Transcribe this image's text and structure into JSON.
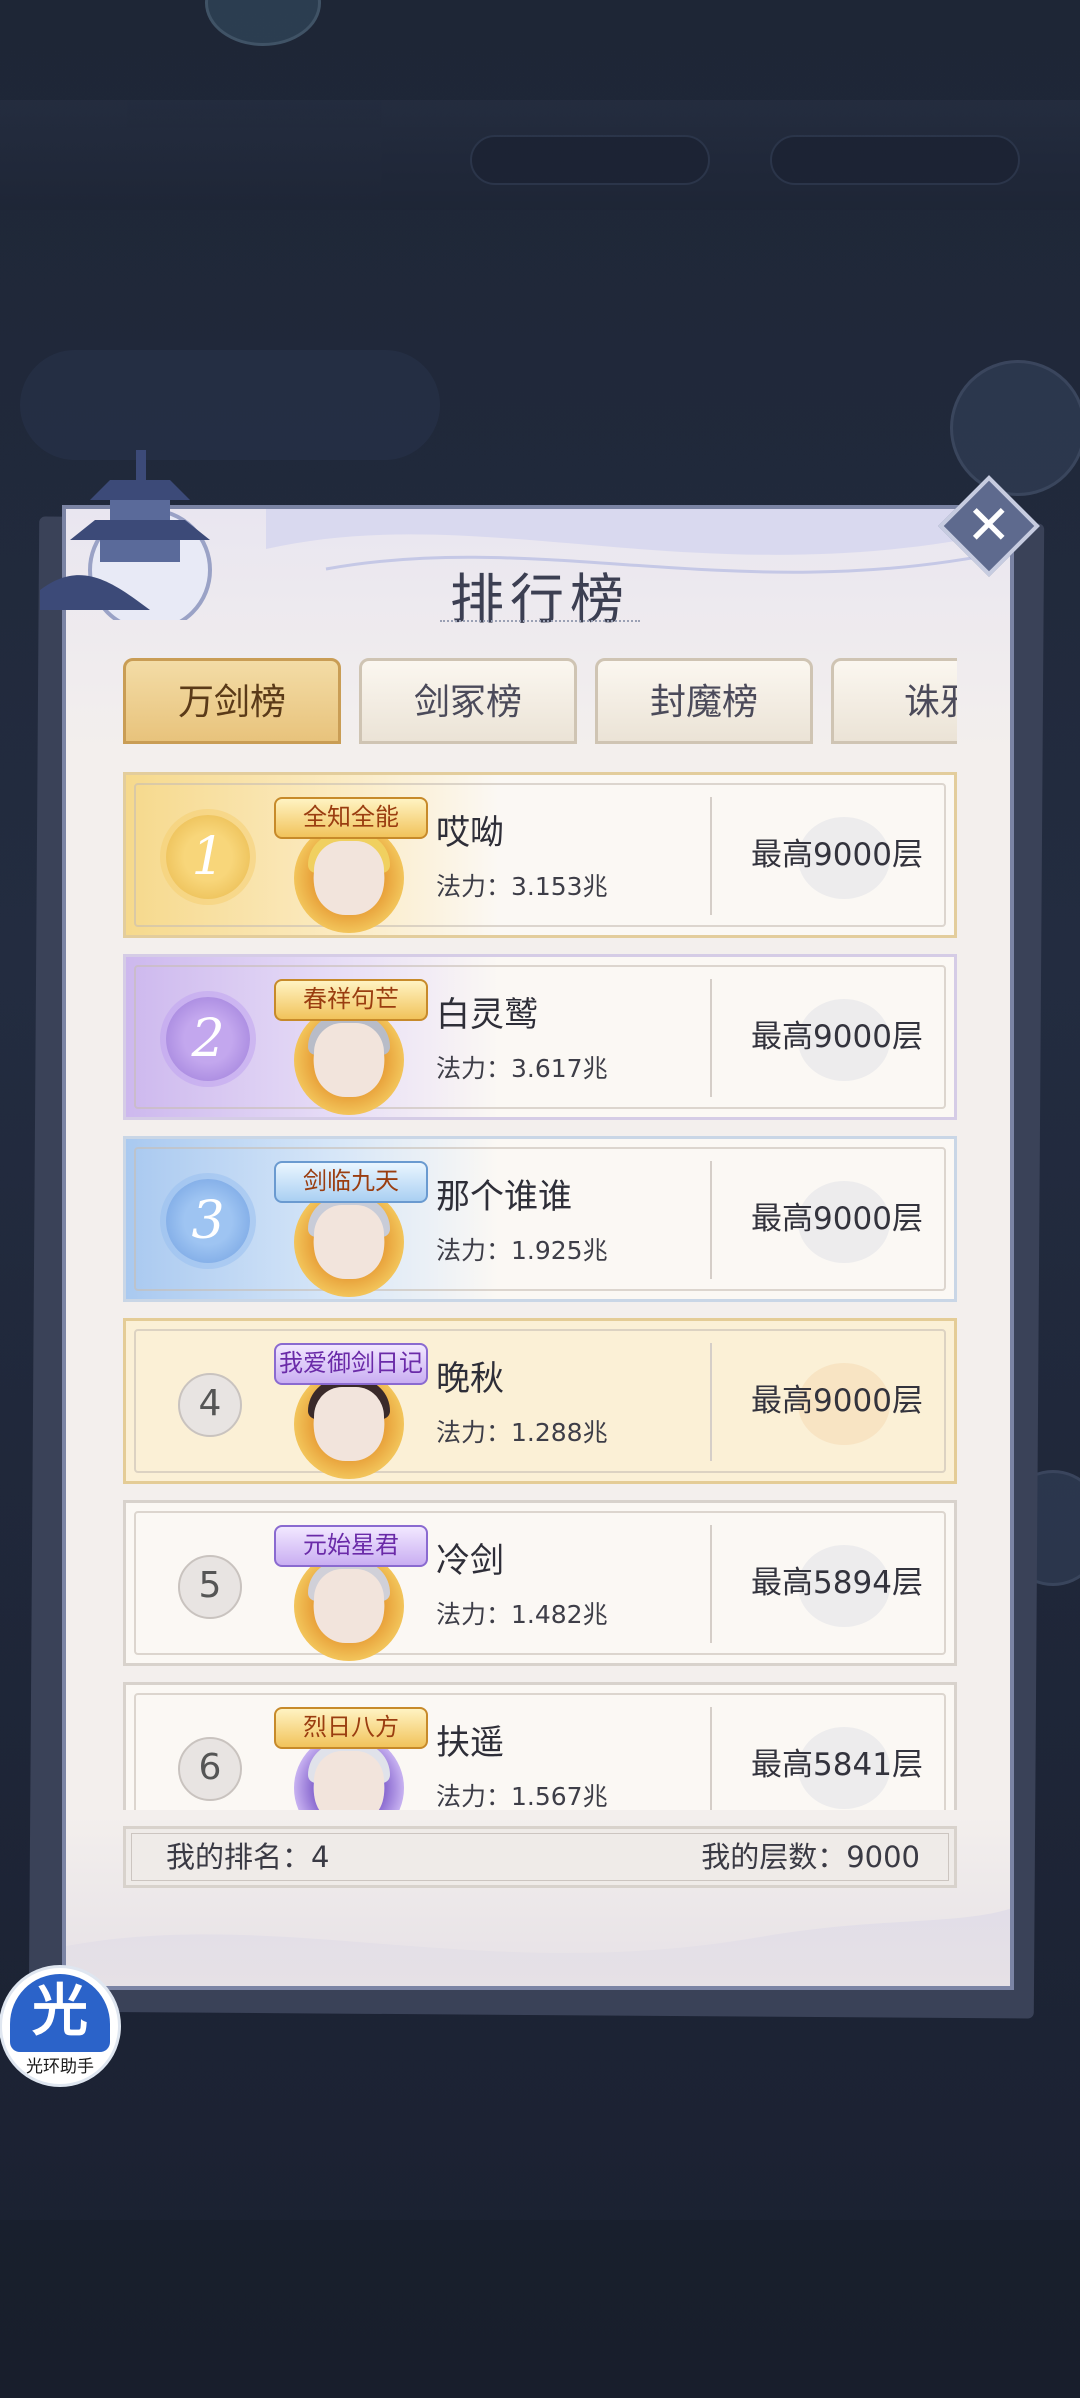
{
  "modal": {
    "title": "排行榜",
    "close_symbol": "✕"
  },
  "tabs": [
    {
      "label": "万剑榜",
      "active": true
    },
    {
      "label": "剑冢榜",
      "active": false
    },
    {
      "label": "封魔榜",
      "active": false
    },
    {
      "label": "诛邪",
      "active": false
    }
  ],
  "ranking": [
    {
      "rank": "1",
      "name": "哎呦",
      "title_badge": "全知全能",
      "power": "法力：3.153兆",
      "record": "最高9000层"
    },
    {
      "rank": "2",
      "name": "白灵鹫",
      "title_badge": "春祥句芒",
      "power": "法力：3.617兆",
      "record": "最高9000层"
    },
    {
      "rank": "3",
      "name": "那个谁谁",
      "title_badge": "剑临九天",
      "power": "法力：1.925兆",
      "record": "最高9000层"
    },
    {
      "rank": "4",
      "name": "晚秋",
      "title_badge": "我爱御剑日记",
      "power": "法力：1.288兆",
      "record": "最高9000层"
    },
    {
      "rank": "5",
      "name": "冷剑",
      "title_badge": "元始星君",
      "power": "法力：1.482兆",
      "record": "最高5894层"
    },
    {
      "rank": "6",
      "name": "扶遥",
      "title_badge": "烈日八方",
      "power": "法力：1.567兆",
      "record": "最高5841层"
    }
  ],
  "my_status": {
    "rank_text": "我的排名：4",
    "floor_text": "我的层数：9000"
  },
  "assistant": {
    "glyph": "光",
    "label": "光环助手"
  },
  "colors": {
    "gold": "#f1c35b",
    "purple": "#9a7ad8",
    "blue": "#6f9ee0",
    "accent_blue": "#2b63c9"
  }
}
